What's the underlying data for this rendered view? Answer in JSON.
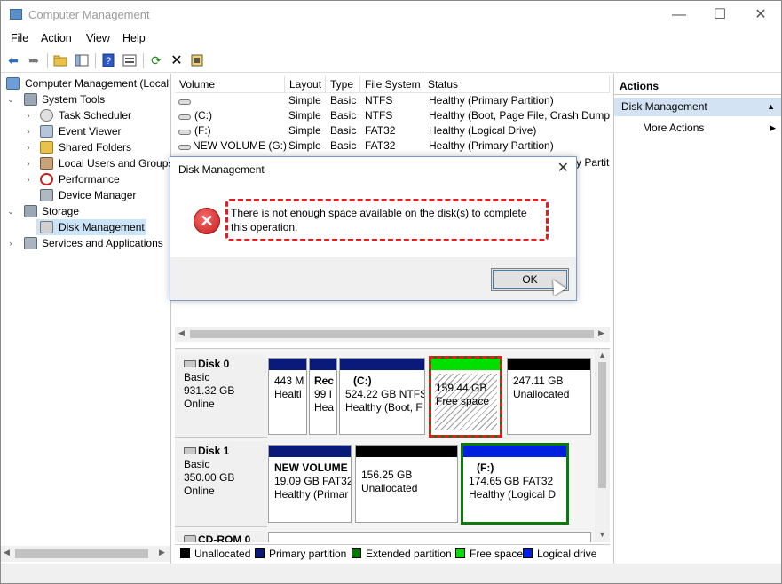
{
  "window": {
    "title": "Computer Management",
    "controls": {
      "minimize": "—",
      "maximize": "☐",
      "close": "✕"
    }
  },
  "menu": [
    "File",
    "Action",
    "View",
    "Help"
  ],
  "toolbar": {
    "icons": [
      "back-arrow-icon",
      "forward-arrow-icon",
      "up-folder-icon",
      "show-hide-tree-icon",
      "help-icon",
      "properties-icon",
      "refresh-icon",
      "delete-icon",
      "settings-icon"
    ]
  },
  "tree": {
    "root": "Computer Management (Local",
    "system_tools": "System Tools",
    "task_scheduler": "Task Scheduler",
    "event_viewer": "Event Viewer",
    "shared_folders": "Shared Folders",
    "local_users": "Local Users and Groups",
    "performance": "Performance",
    "device_manager": "Device Manager",
    "storage": "Storage",
    "disk_management": "Disk Management",
    "services": "Services and Applications"
  },
  "list": {
    "headers": [
      "Volume",
      "Layout",
      "Type",
      "File System",
      "Status"
    ],
    "rows": [
      {
        "volume": "",
        "layout": "Simple",
        "type": "Basic",
        "fs": "NTFS",
        "status": "Healthy (Primary Partition)"
      },
      {
        "volume": "(C:)",
        "layout": "Simple",
        "type": "Basic",
        "fs": "NTFS",
        "status": "Healthy (Boot, Page File, Crash Dump,"
      },
      {
        "volume": "(F:)",
        "layout": "Simple",
        "type": "Basic",
        "fs": "FAT32",
        "status": "Healthy (Logical Drive)"
      },
      {
        "volume": "NEW VOLUME (G:)",
        "layout": "Simple",
        "type": "Basic",
        "fs": "FAT32",
        "status": "Healthy (Primary Partition)"
      }
    ],
    "partial_status": "y Partit"
  },
  "disks": {
    "disk0": {
      "name": "Disk 0",
      "type": "Basic",
      "size": "931.32 GB",
      "state": "Online",
      "parts": [
        {
          "line1": "443 M",
          "line2": "Healtl"
        },
        {
          "line1": "Rec",
          "line2": "99 I",
          "line3": "Hea"
        },
        {
          "line1": "(C:)",
          "line2": "524.22 GB NTFS",
          "line3": "Healthy (Boot, F"
        },
        {
          "line1": "159.44 GB",
          "line2": "Free space"
        },
        {
          "line1": "247.11 GB",
          "line2": "Unallocated"
        }
      ]
    },
    "disk1": {
      "name": "Disk 1",
      "type": "Basic",
      "size": "350.00 GB",
      "state": "Online",
      "parts": [
        {
          "line1": "NEW VOLUME",
          "line2": "19.09 GB FAT32",
          "line3": "Healthy (Primar"
        },
        {
          "line1": "156.25 GB",
          "line2": "Unallocated"
        },
        {
          "line1": "(F:)",
          "line2": "174.65 GB FAT32",
          "line3": "Healthy (Logical D"
        }
      ]
    },
    "cdrom": "CD-ROM 0"
  },
  "legend": [
    "Unallocated",
    "Primary partition",
    "Extended partition",
    "Free space",
    "Logical drive"
  ],
  "legend_colors": [
    "#000000",
    "#0a1a7a",
    "#007a00",
    "#00e000",
    "#0020e0"
  ],
  "actions": {
    "header": "Actions",
    "section": "Disk Management",
    "item": "More Actions"
  },
  "dialog": {
    "title": "Disk Management",
    "message": "There is not enough space available on the disk(s) to complete this operation.",
    "ok": "OK"
  }
}
